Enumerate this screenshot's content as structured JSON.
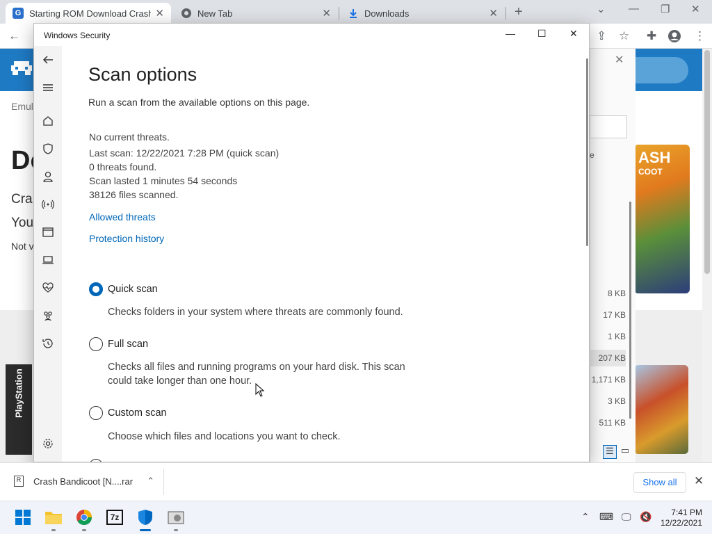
{
  "browser": {
    "tabs": [
      {
        "title": "Starting ROM Download Crash B",
        "favicon": "G",
        "active": true
      },
      {
        "title": "New Tab",
        "active": false
      },
      {
        "title": "Downloads",
        "active": false
      }
    ],
    "new_tab_glyph": "+"
  },
  "background_page": {
    "breadcrumb": "Emul",
    "heading": "Do",
    "line1": "Cra",
    "line2": "You",
    "line3": "Not v",
    "search_pill": "s...",
    "cover_text": "ASH",
    "cover_sub": "COOT",
    "playstation_label": "PlayStation"
  },
  "downloads_panel": {
    "letter": "e",
    "sizes": [
      "8 KB",
      "17 KB",
      "1 KB",
      "207 KB",
      "1,171 KB",
      "3 KB",
      "511 KB"
    ]
  },
  "window": {
    "title": "Windows Security",
    "controls": {
      "minimize": "—",
      "maximize": "☐",
      "close": "✕"
    }
  },
  "scan_options": {
    "heading": "Scan options",
    "description": "Run a scan from the available options on this page.",
    "status_lines": [
      "No current threats.",
      "Last scan: 12/22/2021 7:28 PM (quick scan)",
      "0 threats found.",
      "Scan lasted 1 minutes 54 seconds",
      "38126 files scanned."
    ],
    "links": {
      "allowed": "Allowed threats",
      "history": "Protection history"
    },
    "options": [
      {
        "label": "Quick scan",
        "desc": "Checks folders in your system where threats are commonly found.",
        "selected": true
      },
      {
        "label": "Full scan",
        "desc": "Checks all files and running programs on your hard disk. This scan could take longer than one hour.",
        "selected": false
      },
      {
        "label": "Custom scan",
        "desc": "Choose which files and locations you want to check.",
        "selected": false
      }
    ]
  },
  "nav_icons": [
    "back-arrow-icon",
    "hamburger-menu-icon",
    "home-icon",
    "shield-icon",
    "account-icon",
    "network-icon",
    "app-browser-icon",
    "device-security-icon",
    "health-icon",
    "family-icon",
    "history-icon",
    "settings-icon"
  ],
  "download_shelf": {
    "file": "Crash Bandicoot [N....rar",
    "show_all": "Show all"
  },
  "taskbar": {
    "time": "7:41 PM",
    "date": "12/22/2021",
    "apps": [
      "windows-start-icon",
      "file-explorer-icon",
      "chrome-icon",
      "7zip-icon",
      "windows-security-icon",
      "app-icon"
    ]
  },
  "colors": {
    "accent": "#0067b8",
    "chrome_bg": "#dee1e6",
    "page_blue": "#1f7ac4"
  }
}
